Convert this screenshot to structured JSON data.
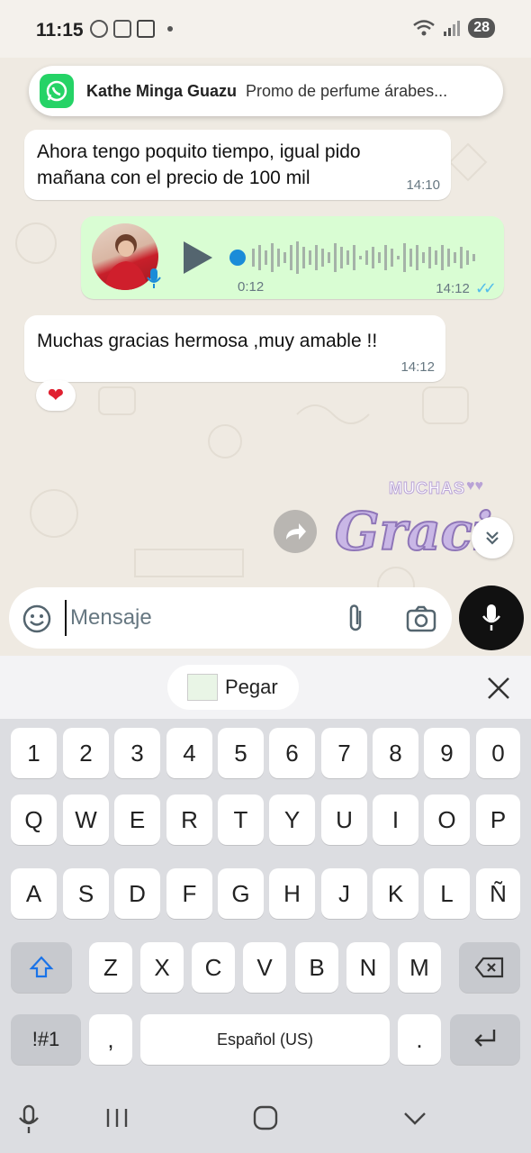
{
  "status_bar": {
    "time": "11:15",
    "battery": "28",
    "icons": [
      "whatsapp-status-icon",
      "screenshot-icon",
      "tiktok-icon",
      "dot-icon",
      "wifi-icon",
      "signal-icon"
    ]
  },
  "notification": {
    "app_icon": "whatsapp-icon",
    "sender": "Kathe Minga Guazu",
    "preview": "Promo de perfume árabes..."
  },
  "messages": [
    {
      "direction": "in",
      "text_line1": "Ahora tengo poquito tiempo, igual pido",
      "text_line2": "mañana con el precio de 100 mil",
      "time": "14:10"
    },
    {
      "direction": "out",
      "type": "voice",
      "duration": "0:12",
      "time": "14:12",
      "status": "read"
    },
    {
      "direction": "in",
      "text": "Muchas gracias hermosa ,muy amable !!",
      "time": "14:12",
      "reaction": "❤"
    }
  ],
  "sticker": {
    "line1": "MUCHAS",
    "line2": "Gracias"
  },
  "input": {
    "placeholder": "Mensaje"
  },
  "keyboard": {
    "paste_label": "Pegar",
    "row_numbers": [
      "1",
      "2",
      "3",
      "4",
      "5",
      "6",
      "7",
      "8",
      "9",
      "0"
    ],
    "row_q": [
      "Q",
      "W",
      "E",
      "R",
      "T",
      "Y",
      "U",
      "I",
      "O",
      "P"
    ],
    "row_a": [
      "A",
      "S",
      "D",
      "F",
      "G",
      "H",
      "J",
      "K",
      "L",
      "Ñ"
    ],
    "row_z": [
      "Z",
      "X",
      "C",
      "V",
      "B",
      "N",
      "M"
    ],
    "symbols_key": "!#1",
    "comma_key": ",",
    "space_label": "Español (US)",
    "period_key": "."
  },
  "colors": {
    "chat_bg": "#efeae2",
    "outgoing_bubble": "#d9fdd3",
    "whatsapp_green": "#25d366",
    "read_ticks": "#53bdeb",
    "sticker_purple": "#b9a3d6"
  }
}
